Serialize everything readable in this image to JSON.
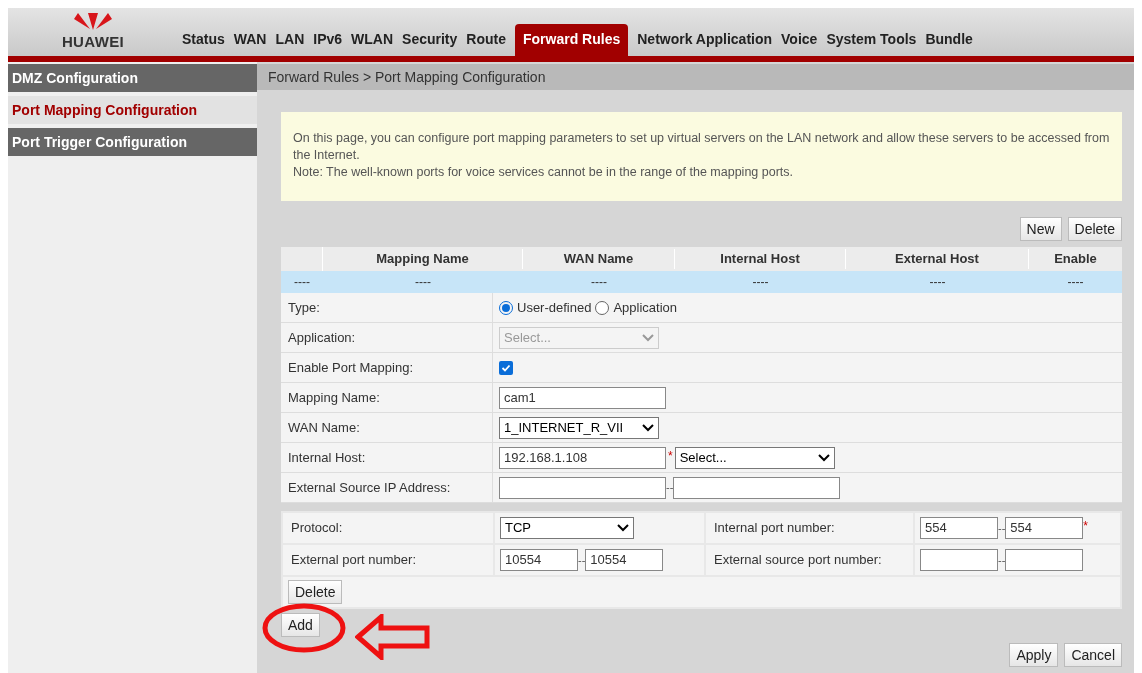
{
  "header": {
    "logo": "HUAWEI",
    "tabs": [
      {
        "label": "Status",
        "selected": false
      },
      {
        "label": "WAN",
        "selected": false
      },
      {
        "label": "LAN",
        "selected": false
      },
      {
        "label": "IPv6",
        "selected": false
      },
      {
        "label": "WLAN",
        "selected": false
      },
      {
        "label": "Security",
        "selected": false
      },
      {
        "label": "Route",
        "selected": false
      },
      {
        "label": "Forward Rules",
        "selected": true
      },
      {
        "label": "Network Application",
        "selected": false
      },
      {
        "label": "Voice",
        "selected": false
      },
      {
        "label": "System Tools",
        "selected": false
      },
      {
        "label": "Bundle",
        "selected": false
      }
    ]
  },
  "sidebar": {
    "items": [
      {
        "label": "DMZ Configuration",
        "selected": false
      },
      {
        "label": "Port Mapping Configuration",
        "selected": true
      },
      {
        "label": "Port Trigger Configuration",
        "selected": false
      }
    ]
  },
  "breadcrumb": "Forward Rules > Port Mapping Configuration",
  "notice": {
    "description": "On this page, you can configure port mapping parameters to set up virtual servers on the LAN network and allow these servers to be accessed from the Internet.",
    "note": "Note: The well-known ports for voice services cannot be in the range of the mapping ports."
  },
  "table_buttons": [
    "New",
    "Delete"
  ],
  "table": {
    "columns": [
      "",
      "Mapping Name",
      "WAN Name",
      "Internal Host",
      "External Host",
      "Enable"
    ],
    "rows": [
      [
        "----",
        "----",
        "----",
        "----",
        "----",
        "----"
      ]
    ]
  },
  "form": [
    {
      "kind": "radio",
      "label": "Type:",
      "options": [
        {
          "label": "User-defined",
          "selected": true
        },
        {
          "label": "Application",
          "selected": false
        }
      ]
    },
    {
      "kind": "select",
      "label": "Application:",
      "value": "Select...",
      "disabled": true
    },
    {
      "kind": "checkbox",
      "label": "Enable Port Mapping:",
      "checked": true
    },
    {
      "kind": "text",
      "label": "Mapping Name:",
      "value": "cam1"
    },
    {
      "kind": "select",
      "label": "WAN Name:",
      "value": "1_INTERNET_R_VII",
      "disabled": false
    },
    {
      "kind": "host",
      "label": "Internal Host:",
      "value": "192.168.1.108",
      "required": "*",
      "select": "Select..."
    },
    {
      "kind": "range",
      "label": "External Source IP Address:",
      "separator": "--"
    }
  ],
  "ports": {
    "rows": [
      [
        {
          "label": "Protocol:",
          "kind": "select",
          "value": "TCP"
        },
        {
          "label": "Internal port number:",
          "kind": "range",
          "from": "554",
          "separator": "--",
          "to": "554",
          "required": "*"
        }
      ],
      [
        {
          "label": "External port number:",
          "kind": "range",
          "from": "10554",
          "separator": "--",
          "to": "10554"
        },
        {
          "label": "External source port number:",
          "kind": "range",
          "separator": "--"
        }
      ]
    ],
    "delete": "Delete"
  },
  "add": "Add",
  "buttons": [
    "Apply",
    "Cancel"
  ]
}
